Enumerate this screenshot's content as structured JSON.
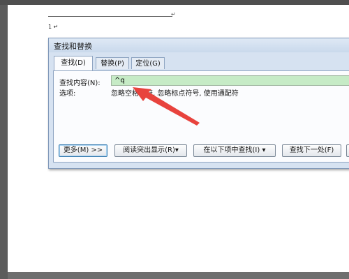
{
  "document": {
    "footnote_number": "1",
    "paragraph_mark": "↵"
  },
  "dialog": {
    "title": "查找和替换",
    "tabs": [
      {
        "label": "查找(D)",
        "active": true
      },
      {
        "label": "替换(P)",
        "active": false
      },
      {
        "label": "定位(G)",
        "active": false
      }
    ],
    "find_label": "查找内容(N):",
    "find_value": "^q",
    "options_label": "选项:",
    "options_value": "忽略空格字符, 忽略标点符号, 使用通配符",
    "buttons": {
      "more": "更多(M) >>",
      "reading_highlight": "阅读突出显示(R)▾",
      "find_in": "在以下项中查找(I) ▾",
      "find_next": "查找下一处(F)"
    }
  },
  "colors": {
    "find_input_bg": "#c6ebc6",
    "annotation_arrow": "#e8433d"
  }
}
